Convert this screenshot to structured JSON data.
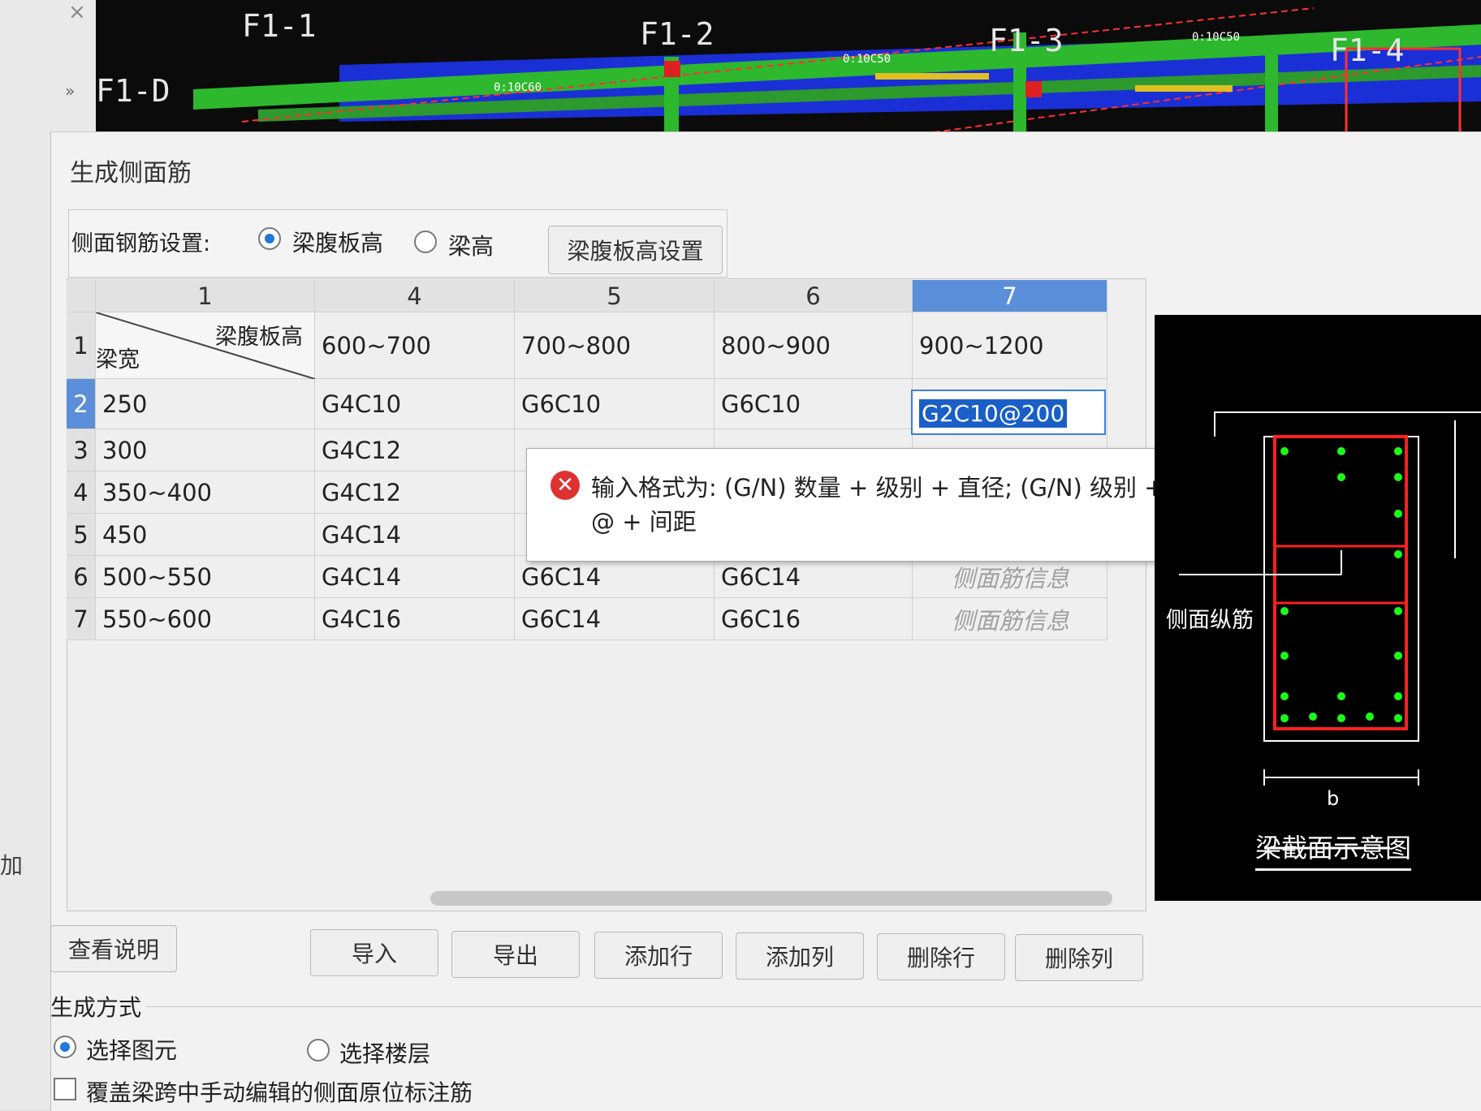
{
  "cad": {
    "labels": [
      "F1-1",
      "F1-2",
      "F1-3",
      "F1-4",
      "F1-D"
    ],
    "small_notes": [
      "0:10C50",
      "0:10C50",
      "0:10C60"
    ]
  },
  "dialog": {
    "title": "生成侧面筋",
    "setting_label": "侧面钢筋设置:",
    "radio_web_height": "梁腹板高",
    "radio_beam_height": "梁高",
    "web_height_button": "梁腹板高设置"
  },
  "table": {
    "col_headers": [
      "1",
      "4",
      "5",
      "6",
      "7"
    ],
    "corner_top": "梁腹板高",
    "corner_bottom": "梁宽",
    "height_ranges": [
      "600~700",
      "700~800",
      "800~900",
      "900~1200"
    ],
    "rows": [
      {
        "num": "2",
        "width": "250",
        "c4": "G4C10",
        "c5": "G6C10",
        "c6": "G6C10",
        "c7": "G2C10@200"
      },
      {
        "num": "3",
        "width": "300",
        "c4": "G4C12",
        "c5": "",
        "c6": "",
        "c7": ""
      },
      {
        "num": "4",
        "width": "350~400",
        "c4": "G4C12",
        "c5": "",
        "c6": "",
        "c7": ""
      },
      {
        "num": "5",
        "width": "450",
        "c4": "G4C14",
        "c5": "",
        "c6": "",
        "c7": ""
      },
      {
        "num": "6",
        "width": "500~550",
        "c4": "G4C14",
        "c5": "G6C14",
        "c6": "G6C14",
        "c7": "侧面筋信息"
      },
      {
        "num": "7",
        "width": "550~600",
        "c4": "G4C16",
        "c5": "G6C14",
        "c6": "G6C16",
        "c7": "侧面筋信息"
      }
    ],
    "header_row_num": "1"
  },
  "tooltip": {
    "icon": "error-icon",
    "text": "输入格式为: (G/N) 数量 + 级别 + 直径; (G/N) 级别 + 直径 + @ + 间距"
  },
  "diagram": {
    "side_label": "侧面纵筋",
    "b_label": "b",
    "caption": "梁截面示意图"
  },
  "buttons": {
    "help": "查看说明",
    "import": "导入",
    "export": "导出",
    "add_row": "添加行",
    "add_col": "添加列",
    "del_row": "删除行",
    "del_col": "删除列"
  },
  "generate": {
    "label": "生成方式",
    "opt_element": "选择图元",
    "opt_floor": "选择楼层",
    "overwrite": "覆盖梁跨中手动编辑的侧面原位标注筋"
  },
  "background": {
    "side_text": "加"
  },
  "colors": {
    "accent": "#1f7ad8",
    "error": "#e03131",
    "selection": "#1a5fc8"
  }
}
